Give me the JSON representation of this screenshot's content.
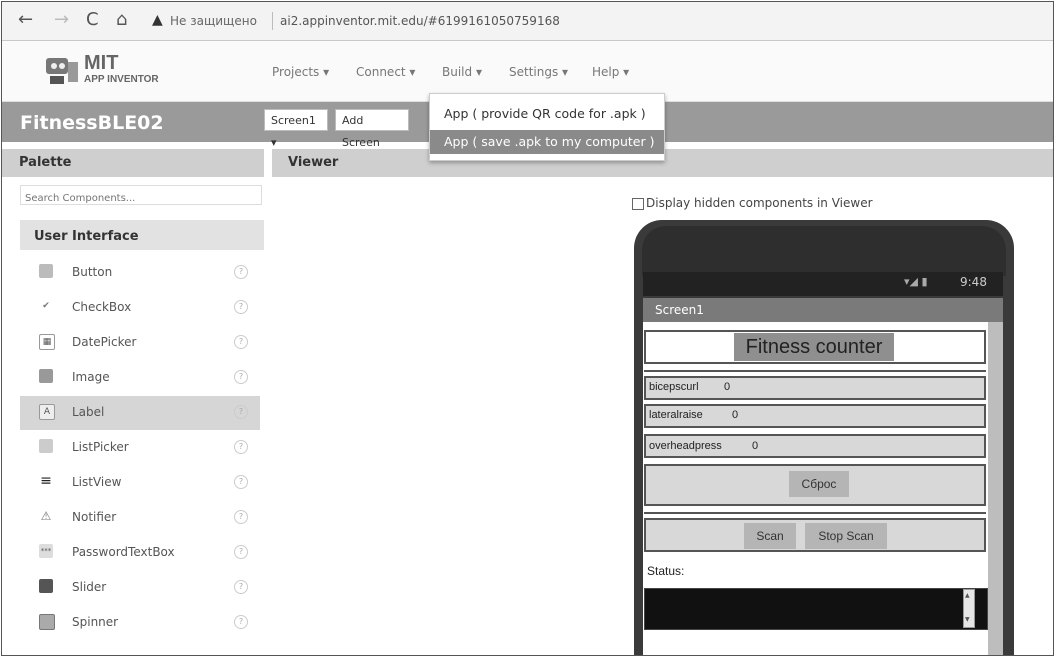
{
  "browser": {
    "back": "←",
    "forward": "→",
    "reload": "C",
    "home": "⌂",
    "warning": "▲",
    "not_secure": "Не защищено",
    "url": "ai2.appinventor.mit.edu/#6199161050759168"
  },
  "logo": {
    "line1": "MIT",
    "line2": "APP INVENTOR"
  },
  "menu": [
    {
      "label": "Projects ▾"
    },
    {
      "label": "Connect ▾"
    },
    {
      "label": "Build ▾"
    },
    {
      "label": "Settings ▾"
    },
    {
      "label": "Help ▾"
    }
  ],
  "project": {
    "title": "FitnessBLE02",
    "screen_select": "Screen1 ▾",
    "add_screen": "Add Screen"
  },
  "build_menu": {
    "items": [
      {
        "label": "App ( provide QR code for .apk )"
      },
      {
        "label": "App ( save .apk to my computer )"
      }
    ]
  },
  "palette": {
    "header": "Palette",
    "search_placeholder": "Search Components...",
    "category": "User Interface",
    "help_glyph": "?",
    "items": [
      {
        "label": "Button",
        "icon": "button-icon"
      },
      {
        "label": "CheckBox",
        "icon": "checkbox-icon"
      },
      {
        "label": "DatePicker",
        "icon": "datepicker-icon"
      },
      {
        "label": "Image",
        "icon": "image-icon"
      },
      {
        "label": "Label",
        "icon": "label-icon",
        "glyph": "A"
      },
      {
        "label": "ListPicker",
        "icon": "listpicker-icon"
      },
      {
        "label": "ListView",
        "icon": "listview-icon",
        "glyph": "≡"
      },
      {
        "label": "Notifier",
        "icon": "notifier-icon",
        "glyph": "⚠"
      },
      {
        "label": "PasswordTextBox",
        "icon": "passwordtextbox-icon",
        "glyph": "***"
      },
      {
        "label": "Slider",
        "icon": "slider-icon"
      },
      {
        "label": "Spinner",
        "icon": "spinner-icon"
      }
    ]
  },
  "viewer": {
    "header": "Viewer",
    "hidden_components": "Display hidden components in Viewer"
  },
  "phone": {
    "time": "9:48",
    "status_icons": "▾◢ ▮",
    "screen_title": "Screen1",
    "app_title": "Fitness counter",
    "rows": [
      {
        "label": "bicepscurl",
        "value": "0"
      },
      {
        "label": "lateralraise",
        "value": "0"
      },
      {
        "label": "overheadpress",
        "value": "0"
      }
    ],
    "reset": "Сброс",
    "scan": "Scan",
    "stop_scan": "Stop Scan",
    "status_label": "Status:",
    "scroll_up": "▲",
    "scroll_down": "▼"
  }
}
